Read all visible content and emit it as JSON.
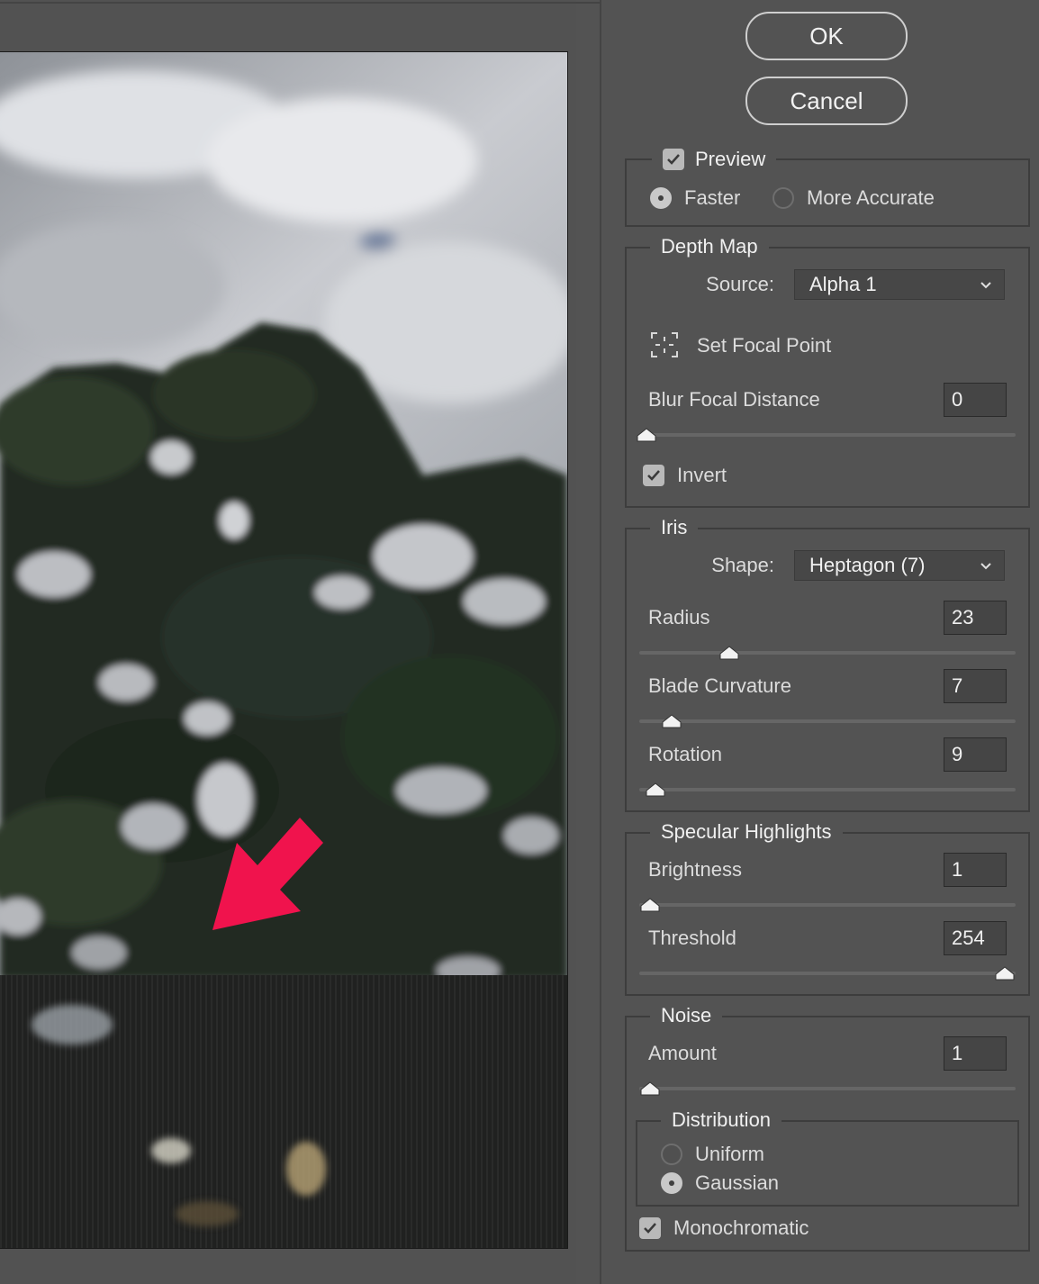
{
  "buttons": {
    "ok": "OK",
    "cancel": "Cancel"
  },
  "preview": {
    "checkbox_label": "Preview",
    "checked": true,
    "options": [
      "Faster",
      "More Accurate"
    ],
    "selected": "Faster"
  },
  "depth_map": {
    "legend": "Depth Map",
    "source_label": "Source:",
    "source_value": "Alpha 1",
    "focal_point_label": "Set Focal Point",
    "blur_focal_distance": {
      "label": "Blur Focal Distance",
      "value": "0",
      "level": 0
    },
    "invert_label": "Invert",
    "invert_checked": true
  },
  "iris": {
    "legend": "Iris",
    "shape_label": "Shape:",
    "shape_value": "Heptagon (7)",
    "radius": {
      "label": "Radius",
      "value": "23",
      "level": 23
    },
    "blade_curvature": {
      "label": "Blade Curvature",
      "value": "7",
      "level": 7
    },
    "rotation": {
      "label": "Rotation",
      "value": "9",
      "level": 9
    }
  },
  "specular": {
    "legend": "Specular Highlights",
    "brightness": {
      "label": "Brightness",
      "value": "1",
      "level": 1
    },
    "threshold": {
      "label": "Threshold",
      "value": "254",
      "level": 254
    }
  },
  "noise": {
    "legend": "Noise",
    "amount": {
      "label": "Amount",
      "value": "1",
      "level": 1
    },
    "distribution_legend": "Distribution",
    "distribution_options": [
      "Uniform",
      "Gaussian"
    ],
    "distribution_selected": "Gaussian",
    "monochromatic_label": "Monochromatic",
    "monochromatic_checked": true
  },
  "colors": {
    "panel_bg": "#535353",
    "annotation_arrow": "#f0134d"
  }
}
